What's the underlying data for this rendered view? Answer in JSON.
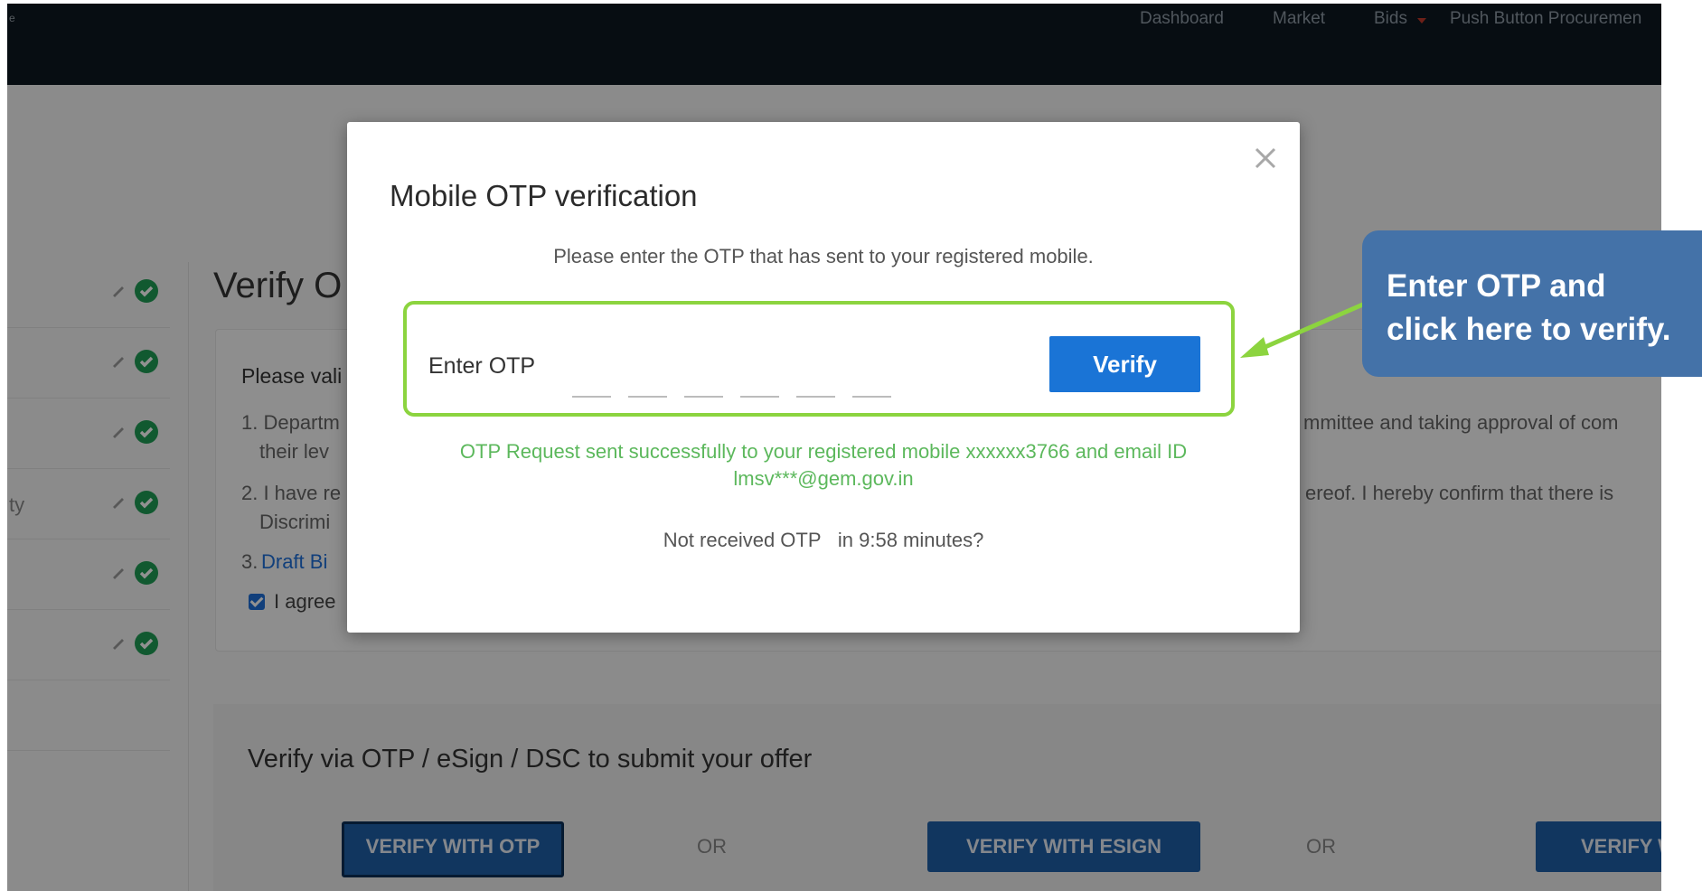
{
  "navbar": {
    "brand_fragment": "e",
    "links": [
      "Dashboard",
      "Market",
      "Bids",
      "Push Button Procuremen"
    ]
  },
  "sidebar": {
    "partial_label": "ty",
    "step_count": 6
  },
  "page": {
    "title_fragment": "Verify O",
    "terms": {
      "heading_fragment": "Please vali",
      "item1_left": "1. Departm",
      "item1_left_line2": "their lev",
      "item1_right": "mmittee and taking approval of com",
      "item2_left": "2. I have re",
      "item2_left_line2": "Discrimi",
      "item2_right": "ereof. I hereby confirm that there is",
      "item3_prefix": "3. ",
      "item3_link": "Draft Bi",
      "agree_fragment": "I agree"
    },
    "submit": {
      "title": "Verify via OTP / eSign / DSC to submit your offer",
      "btn_otp": "VERIFY WITH OTP",
      "or": "OR",
      "btn_esign": "VERIFY WITH ESIGN",
      "btn_dsc_fragment": "VERIFY W"
    }
  },
  "modal": {
    "title": "Mobile OTP verification",
    "instruction": "Please enter the OTP that has sent to your registered mobile.",
    "otp_label": "Enter OTP",
    "otp_digit_count": 6,
    "verify_label": "Verify",
    "success_line1": "OTP Request sent successfully to your registered mobile xxxxxx3766 and email ID",
    "success_line2": "lmsv***@gem.gov.in",
    "resend_prefix": "Not received OTP",
    "resend_timer": "in 9:58 minutes?"
  },
  "callout": {
    "text": "Enter OTP and click here to verify."
  },
  "colors": {
    "navbar": "#0d1721",
    "primary_button": "#1a74d6",
    "highlight_border": "#8cd43f",
    "success_text": "#5cb85c",
    "callout_bg": "#4472a8",
    "check_green": "#1f9d55"
  },
  "icons": [
    "close-icon",
    "pencil-icon",
    "check-circle-icon",
    "checkbox-checked-icon",
    "callout-arrow-icon"
  ]
}
